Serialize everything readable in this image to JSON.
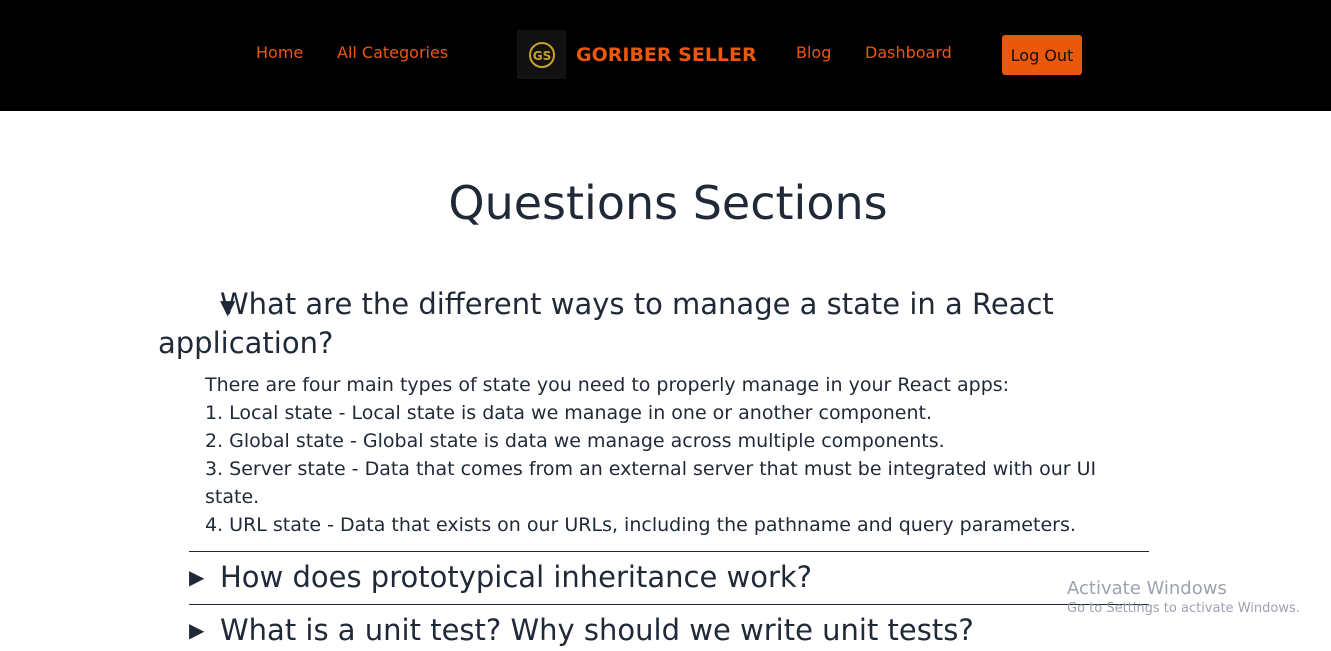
{
  "nav": {
    "home_label": "Home",
    "categories_label": "All Categories",
    "brand_name": "GORIBER SELLER",
    "logo_text": "GS",
    "blog_label": "Blog",
    "dashboard_label": "Dashboard",
    "logout_label": "Log Out"
  },
  "colors": {
    "accent": "#ea580c",
    "navbar_bg": "#000000",
    "text": "#1f2937"
  },
  "page": {
    "title": "Questions Sections"
  },
  "faqs": [
    {
      "question": "What are the different ways to manage a state in a React application?",
      "expanded": true,
      "answer_lines": [
        "There are four main types of state you need to properly manage in your React apps:",
        "1. Local state - Local state is data we manage in one or another component.",
        "2. Global state - Global state is data we manage across multiple components.",
        "3. Server state - Data that comes from an external server that must be integrated with our UI state.",
        "4. URL state - Data that exists on our URLs, including the pathname and query parameters."
      ]
    },
    {
      "question": "How does prototypical inheritance work?",
      "expanded": false
    },
    {
      "question": "What is a unit test? Why should we write unit tests?",
      "expanded": false
    }
  ],
  "watermark": {
    "title": "Activate Windows",
    "subtitle": "Go to Settings to activate Windows."
  }
}
